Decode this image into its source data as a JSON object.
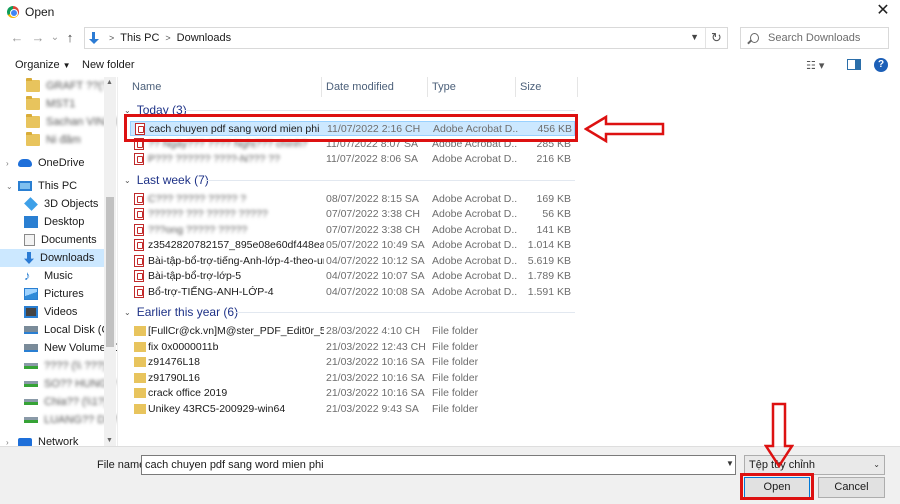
{
  "window": {
    "title": "Open",
    "close_glyph": "✕"
  },
  "nav": {
    "back_glyph": "←",
    "forward_glyph": "→",
    "history_glyph": "⌄",
    "up_glyph": "↑",
    "breadcrumb": [
      "This PC",
      "Downloads"
    ],
    "crumb_sep": ">",
    "refresh_glyph": "↻",
    "search_placeholder": "Search Downloads"
  },
  "toolbar": {
    "organize": "Organize",
    "organize_caret": "▼",
    "new_folder": "New folder",
    "views_glyph": "☷ ▾",
    "help": "?"
  },
  "sidebar": {
    "items": [
      {
        "label": "GRAFT ??(?)",
        "icon": "folder-icon",
        "blurred": true
      },
      {
        "label": "MST1",
        "icon": "folder-icon",
        "blurred": true
      },
      {
        "label": "Sachan VIN2018",
        "icon": "folder-icon",
        "blurred": true
      },
      {
        "label": "Ni đăm",
        "icon": "folder-icon",
        "blurred": true
      },
      {
        "label": "OneDrive",
        "icon": "cloud-icon",
        "blurred": false
      },
      {
        "label": "This PC",
        "icon": "pc-icon",
        "blurred": false
      },
      {
        "label": "3D Objects",
        "icon": "cube-icon",
        "blurred": false
      },
      {
        "label": "Desktop",
        "icon": "desktop-icon",
        "blurred": false
      },
      {
        "label": "Documents",
        "icon": "documents-icon",
        "blurred": false
      },
      {
        "label": "Downloads",
        "icon": "download-icon",
        "blurred": false,
        "selected": true
      },
      {
        "label": "Music",
        "icon": "music-icon",
        "blurred": false
      },
      {
        "label": "Pictures",
        "icon": "pictures-icon",
        "blurred": false
      },
      {
        "label": "Videos",
        "icon": "videos-icon",
        "blurred": false
      },
      {
        "label": "Local Disk (C:)",
        "icon": "disk-icon",
        "blurred": false
      },
      {
        "label": "New Volume (D:",
        "icon": "disk-icon",
        "blurred": false
      },
      {
        "label": "???? (\\\\ ???)",
        "icon": "network-drive-icon",
        "blurred": true
      },
      {
        "label": "SO?? HUNG ?",
        "icon": "network-drive-icon",
        "blurred": true
      },
      {
        "label": "Chia?? (\\\\1?)",
        "icon": "network-drive-icon",
        "blurred": true
      },
      {
        "label": "LUANG?? DE?",
        "icon": "network-drive-icon",
        "blurred": true
      },
      {
        "label": "Network",
        "icon": "network-icon",
        "blurred": false
      }
    ]
  },
  "columns": {
    "name": "Name",
    "date": "Date modified",
    "type": "Type",
    "size": "Size"
  },
  "groups": [
    {
      "title": "Today (3)",
      "rows": [
        {
          "name": "cach chuyen pdf sang word mien phi",
          "date": "11/07/2022 2:16 CH",
          "type": "Adobe Acrobat D...",
          "size": "456 KB",
          "kind": "pdf",
          "selected": true,
          "blurred": false
        },
        {
          "name": "?? Ngày??? ???? Nghị??? chính?",
          "date": "11/07/2022 8:07 SA",
          "type": "Adobe Acrobat D...",
          "size": "285 KB",
          "kind": "pdf",
          "blurred": true
        },
        {
          "name": "P??? ?????? ????-N??? ??",
          "date": "11/07/2022 8:06 SA",
          "type": "Adobe Acrobat D...",
          "size": "216 KB",
          "kind": "pdf",
          "blurred": true
        }
      ]
    },
    {
      "title": "Last week (7)",
      "rows": [
        {
          "name": "C??? ????? ????? ?",
          "date": "08/07/2022 8:15 SA",
          "type": "Adobe Acrobat D...",
          "size": "169 KB",
          "kind": "pdf",
          "blurred": true
        },
        {
          "name": "?????? ??? ????? ?????",
          "date": "07/07/2022 3:38 CH",
          "type": "Adobe Acrobat D...",
          "size": "56 KB",
          "kind": "pdf",
          "blurred": true
        },
        {
          "name": "???ong ????? ?????",
          "date": "07/07/2022 3:38 CH",
          "type": "Adobe Acrobat D...",
          "size": "141 KB",
          "kind": "pdf",
          "blurred": true
        },
        {
          "name": "z3542820782157_895e08e60df448ea2f3bd...",
          "date": "05/07/2022 10:49 SA",
          "type": "Adobe Acrobat D...",
          "size": "1.014 KB",
          "kind": "pdf",
          "blurred": false
        },
        {
          "name": "Bài-tập-bổ-trợ-tiếng-Anh-lớp-4-theo-unit",
          "date": "04/07/2022 10:12 SA",
          "type": "Adobe Acrobat D...",
          "size": "5.619 KB",
          "kind": "pdf",
          "blurred": false
        },
        {
          "name": "Bài-tập-bổ-trợ-lớp-5",
          "date": "04/07/2022 10:07 SA",
          "type": "Adobe Acrobat D...",
          "size": "1.789 KB",
          "kind": "pdf",
          "blurred": false
        },
        {
          "name": "Bổ-trợ-TIẾNG-ANH-LỚP-4",
          "date": "04/07/2022 10:08 SA",
          "type": "Adobe Acrobat D...",
          "size": "1.591 KB",
          "kind": "pdf",
          "blurred": false
        }
      ]
    },
    {
      "title": "Earlier this year (6)",
      "rows": [
        {
          "name": "[FullCr@ck.vn]M@ster_PDF_Edit0r_5.8.03...",
          "date": "28/03/2022 4:10 CH",
          "type": "File folder",
          "size": "",
          "kind": "folder",
          "blurred": false
        },
        {
          "name": "fix 0x0000011b",
          "date": "21/03/2022 12:43 CH",
          "type": "File folder",
          "size": "",
          "kind": "folder",
          "blurred": false
        },
        {
          "name": "z91476L18",
          "date": "21/03/2022 10:16 SA",
          "type": "File folder",
          "size": "",
          "kind": "folder",
          "blurred": false
        },
        {
          "name": "z91790L16",
          "date": "21/03/2022 10:16 SA",
          "type": "File folder",
          "size": "",
          "kind": "folder",
          "blurred": false
        },
        {
          "name": "crack office 2019",
          "date": "21/03/2022 10:16 SA",
          "type": "File folder",
          "size": "",
          "kind": "folder",
          "blurred": false
        },
        {
          "name": "Unikey 43RC5-200929-win64",
          "date": "21/03/2022 9:43 SA",
          "type": "File folder",
          "size": "",
          "kind": "folder",
          "blurred": false
        }
      ]
    }
  ],
  "footer": {
    "filename_label": "File name:",
    "filename_value": "cach chuyen pdf sang word mien phi",
    "filetype_value": "Tệp tùy chỉnh",
    "open_label": "Open",
    "cancel_label": "Cancel"
  },
  "annotations": {
    "color": "#dd1111"
  }
}
